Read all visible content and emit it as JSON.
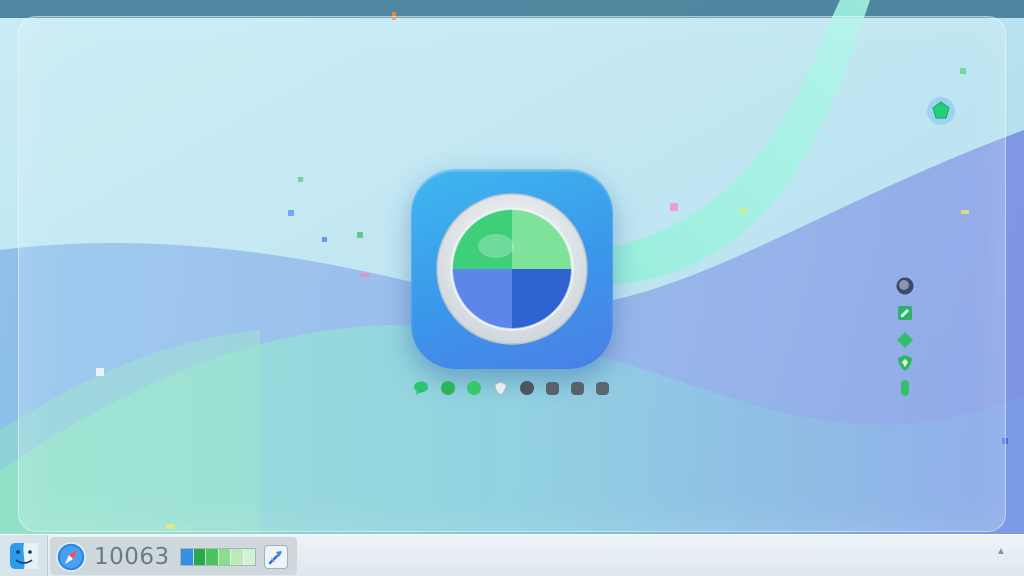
{
  "desktop": {
    "wallpaper_colors": {
      "sky": "#bfe6f2",
      "teal_wave": "#7fd8c5",
      "blue_wave": "#6f8fe6",
      "mint_ribbon": "#8ef0d4"
    }
  },
  "app_icon": {
    "icon": "quad-lens-icon",
    "background": "#3b97ea",
    "quadrant_colors": [
      "#3fcf7a",
      "#7ee29a",
      "#5c86e8",
      "#2f63cf"
    ]
  },
  "page_indicators": [
    {
      "icon": "chat-bubble-icon",
      "color": "#28c76f"
    },
    {
      "icon": "dot-icon",
      "color": "#2fb35a"
    },
    {
      "icon": "dot-icon",
      "color": "#37c86a"
    },
    {
      "icon": "shield-icon",
      "color": "#e8eef2"
    },
    {
      "icon": "dot-icon",
      "color": "#4b5560"
    },
    {
      "icon": "square-icon",
      "color": "#56616b"
    },
    {
      "icon": "square-icon",
      "color": "#56616b"
    },
    {
      "icon": "square-icon",
      "color": "#5b6670"
    }
  ],
  "side_indicators": [
    {
      "icon": "avatar-icon",
      "color": "#3a4a6a"
    },
    {
      "icon": "note-icon",
      "color": "#2fb36b"
    },
    {
      "icon": "diamond-icon",
      "color": "#2fc06a"
    },
    {
      "icon": "shield-icon",
      "color": "#2fb85f"
    },
    {
      "icon": "pill-icon",
      "color": "#35c168"
    }
  ],
  "top_right_badge": {
    "icon": "pentagon-gem-icon",
    "color": "#25d07b"
  },
  "taskbar": {
    "start_icon": "finder-face-icon",
    "tray": {
      "compass_icon": "compass-icon",
      "score": "10063",
      "progress": 0.5,
      "progress_colors": [
        "#3b8de0",
        "#2aa84a",
        "#4cc45d",
        "#90dc8f",
        "#bdeab8",
        "#d7f0d3"
      ],
      "app_button_icon": "xcode-hammer-icon"
    },
    "corner_icon": "arrow-up-icon"
  }
}
